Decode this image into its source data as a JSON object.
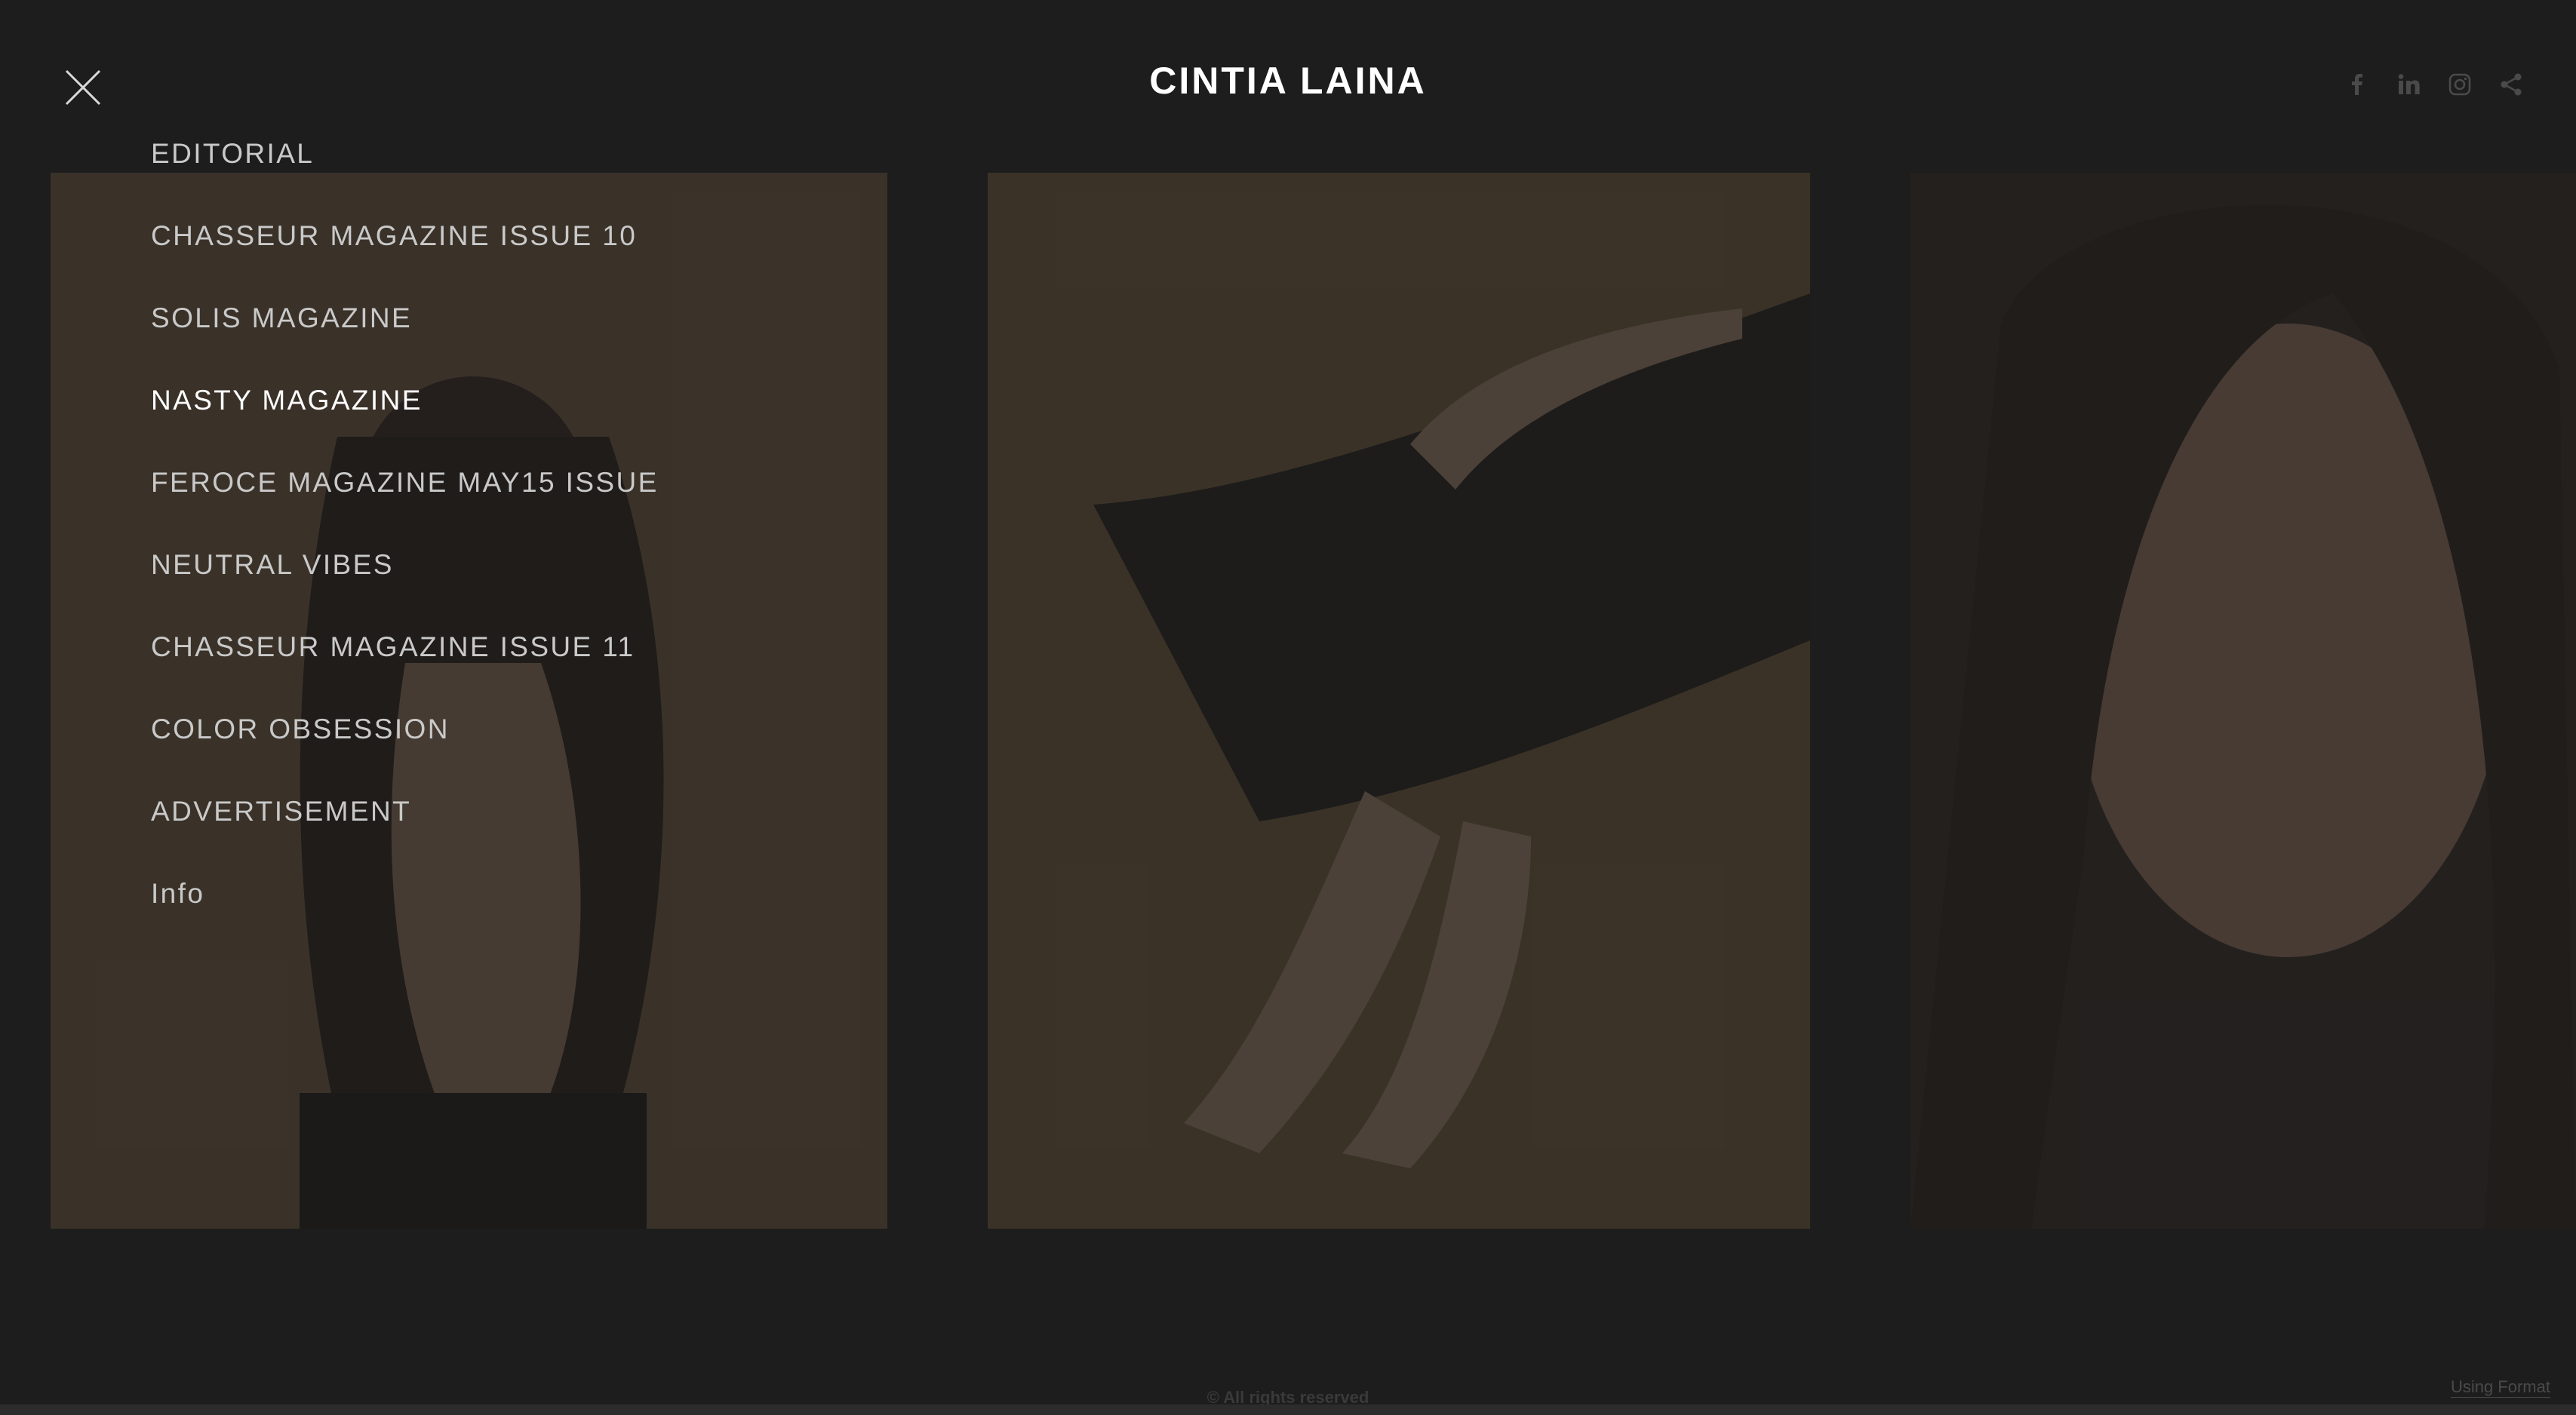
{
  "header": {
    "title": "CINTIA LAINA"
  },
  "social": [
    "facebook-icon",
    "linkedin-icon",
    "instagram-icon",
    "share-icon"
  ],
  "nav": {
    "items": [
      {
        "label": "EDITORIAL"
      },
      {
        "label": "CHASSEUR MAGAZINE ISSUE 10"
      },
      {
        "label": "SOLIS MAGAZINE"
      },
      {
        "label": "NASTY MAGAZINE"
      },
      {
        "label": "FEROCE MAGAZINE MAY15 ISSUE"
      },
      {
        "label": "NEUTRAL VIBES"
      },
      {
        "label": "CHASSEUR MAGAZINE ISSUE 11"
      },
      {
        "label": "COLOR OBSESSION"
      },
      {
        "label": "ADVERTISEMENT"
      },
      {
        "label": "Info"
      }
    ],
    "active_label": "NASTY MAGAZINE"
  },
  "footer": {
    "copyright": "© All rights reserved",
    "using_format": "Using Format"
  },
  "colors": {
    "background": "#212121",
    "active_nav": "#ffffff",
    "nav": "#c9c9c9"
  }
}
